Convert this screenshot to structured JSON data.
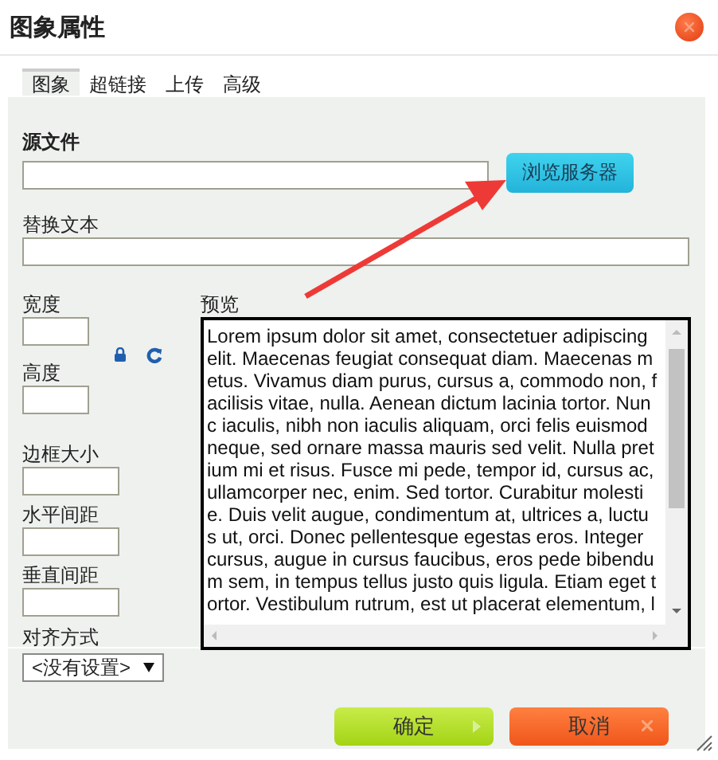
{
  "window": {
    "title": "图象属性"
  },
  "tabs": [
    {
      "label": "图象",
      "selected": true
    },
    {
      "label": "超链接",
      "selected": false
    },
    {
      "label": "上传",
      "selected": false
    },
    {
      "label": "高级",
      "selected": false
    }
  ],
  "source_file": {
    "label": "源文件"
  },
  "browse_button": {
    "label": "浏览服务器"
  },
  "alt_text": {
    "label": "替换文本"
  },
  "width": {
    "label": "宽度"
  },
  "height": {
    "label": "高度"
  },
  "border": {
    "label": "边框大小"
  },
  "hspace": {
    "label": "水平间距"
  },
  "vspace": {
    "label": "垂直间距"
  },
  "align": {
    "label": "对齐方式",
    "value": "<没有设置>"
  },
  "preview": {
    "label": "预览",
    "lines": [
      "Lorem ipsum dolor sit amet, consectetuer adipiscing",
      "elit. Maecenas feugiat consequat diam. Maecenas m",
      "etus. Vivamus diam purus, cursus a, commodo non, f",
      "acilisis vitae, nulla. Aenean dictum lacinia tortor. Nun",
      "c iaculis, nibh non iaculis aliquam, orci felis euismod",
      "neque, sed ornare massa mauris sed velit. Nulla pret",
      "ium mi et risus. Fusce mi pede, tempor id, cursus ac,",
      "ullamcorper nec, enim. Sed tortor. Curabitur molesti",
      "e. Duis velit augue, condimentum at, ultrices a, luctu",
      "s ut, orci. Donec pellentesque egestas eros. Integer",
      "cursus, augue in cursus faucibus, eros pede bibendu",
      "m sem, in tempus tellus justo quis ligula. Etiam eget t",
      "ortor. Vestibulum rutrum, est ut placerat elementum, l"
    ]
  },
  "buttons": [
    {
      "label": "确定",
      "kind": "ok"
    },
    {
      "label": "取消",
      "kind": "cancel"
    }
  ]
}
